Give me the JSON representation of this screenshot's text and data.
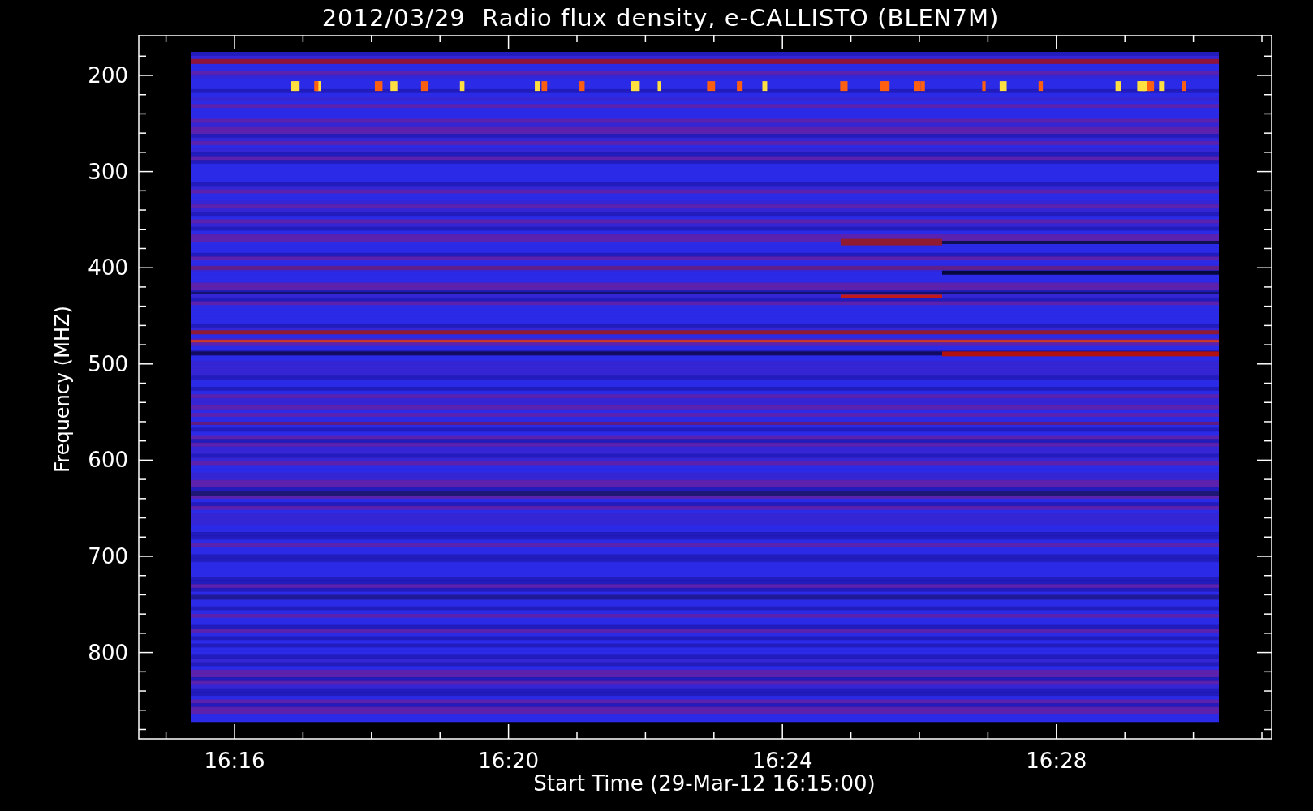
{
  "plot": {
    "title": "2012/03/29  Radio flux density, e-CALLISTO (BLEN7M)",
    "ylabel": "Frequency (MHZ)",
    "xlabel": "Start Time (29-Mar-12 16:15:00)",
    "yticks": [
      "200",
      "300",
      "400",
      "500",
      "600",
      "700",
      "800"
    ],
    "xticks": [
      "16:16",
      "16:20",
      "16:24",
      "16:28"
    ]
  }
}
